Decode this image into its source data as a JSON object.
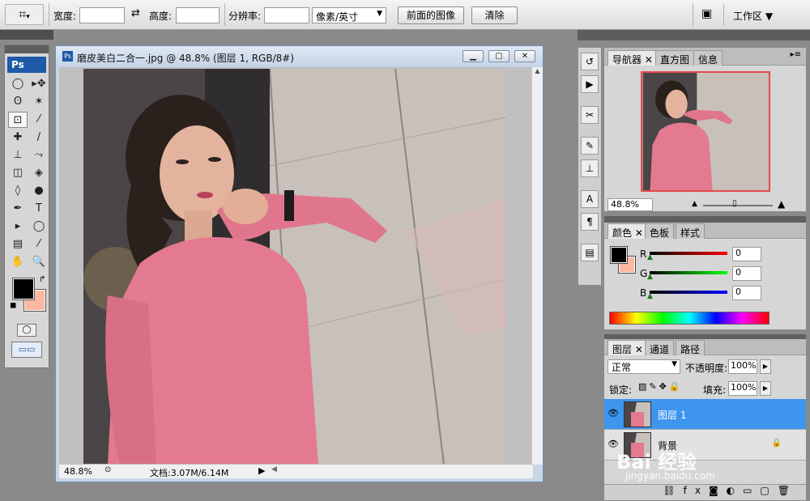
{
  "options_bar": {
    "tool_preset_icon": "crop-icon",
    "width_label": "宽度:",
    "height_label": "高度:",
    "resolution_label": "分辨率:",
    "unit_select": "像素/英寸",
    "front_image_label": "前面的图像",
    "clear_label": "清除",
    "workspace_label": "工作区"
  },
  "toolbox": {
    "logo": "Ps",
    "tools": [
      "marquee-icon",
      "move-icon",
      "lasso-icon",
      "magic-wand-icon",
      "crop-icon",
      "slice-icon",
      "healing-brush-icon",
      "brush-icon",
      "clone-stamp-icon",
      "history-brush-icon",
      "eraser-icon",
      "paint-bucket-icon",
      "blur-icon",
      "dodge-icon",
      "pen-icon",
      "type-icon",
      "path-select-icon",
      "shape-icon",
      "notes-icon",
      "eyedropper-icon",
      "hand-icon",
      "zoom-icon"
    ],
    "tool_glyphs": [
      "◯",
      "▸✥",
      "ʘ",
      "✶",
      "⊡",
      "⁄",
      "✚",
      "/",
      "⊥",
      "⤳",
      "◫",
      "◈",
      "◊",
      "●",
      "✒",
      "T",
      "▸",
      "◯",
      "▤",
      "⁄",
      "✋",
      "🔍"
    ],
    "fg_color": "#000000",
    "bg_color": "#fcb8a1"
  },
  "document": {
    "title": "磨皮美白二合一.jpg @ 48.8% (图层 1, RGB/8#)",
    "zoom": "48.8%",
    "doc_info": "文档:3.07M/6.14M"
  },
  "navigator": {
    "tabs": [
      "导航器",
      "直方图",
      "信息"
    ],
    "zoom": "48.8%"
  },
  "color_panel": {
    "tabs": [
      "颜色",
      "色板",
      "样式"
    ],
    "channels": [
      {
        "label": "R",
        "value": "0"
      },
      {
        "label": "G",
        "value": "0"
      },
      {
        "label": "B",
        "value": "0"
      }
    ]
  },
  "layers_panel": {
    "tabs": [
      "图层",
      "通道",
      "路径"
    ],
    "blend_mode": "正常",
    "opacity_label": "不透明度:",
    "opacity_value": "100%",
    "lock_label": "锁定:",
    "fill_label": "填充:",
    "fill_value": "100%",
    "layers": [
      {
        "name": "图层 1",
        "selected": true
      },
      {
        "name": "背景",
        "selected": false
      }
    ]
  },
  "watermark": {
    "brand": "Bai 经验",
    "url": "jingyan.baidu.com"
  }
}
